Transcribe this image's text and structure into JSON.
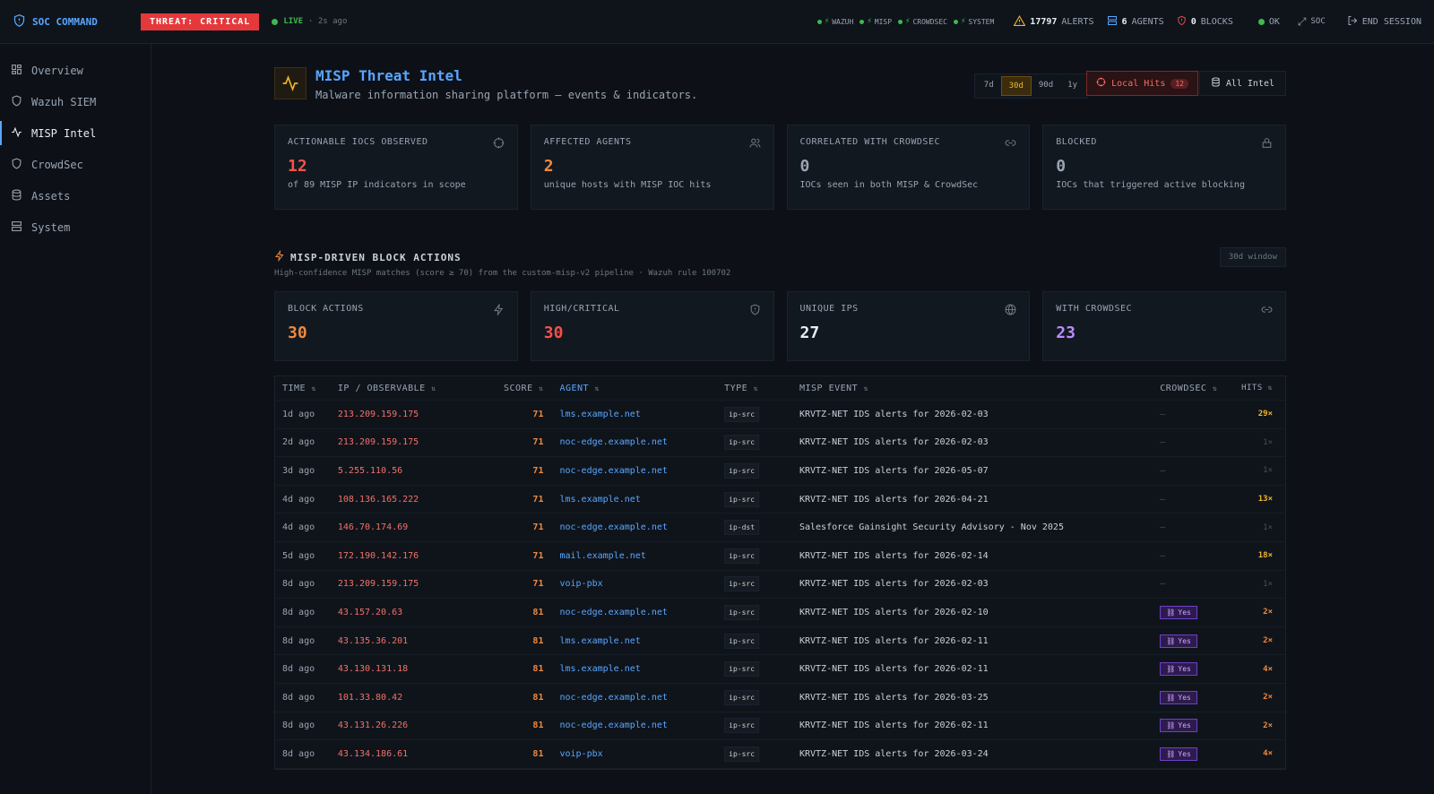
{
  "topbar": {
    "brand": "SOC COMMAND",
    "threat": "THREAT: CRITICAL",
    "live_label": "LIVE",
    "live_time": "· 2s ago",
    "services": [
      "WAZUH",
      "MISP",
      "CROWDSEC",
      "SYSTEM"
    ],
    "alerts_count": "17797",
    "alerts_label": "ALERTS",
    "agents_count": "6",
    "agents_label": "AGENTS",
    "blocks_count": "0",
    "blocks_label": "BLOCKS",
    "ok_label": "OK",
    "soc_label": "SOC",
    "end_session": "END SESSION"
  },
  "sidebar": {
    "items": [
      {
        "label": "Overview",
        "icon": "grid-icon"
      },
      {
        "label": "Wazuh SIEM",
        "icon": "shield-icon"
      },
      {
        "label": "MISP Intel",
        "icon": "activity-icon"
      },
      {
        "label": "CrowdSec",
        "icon": "shield-icon"
      },
      {
        "label": "Assets",
        "icon": "database-icon"
      },
      {
        "label": "System",
        "icon": "server-icon"
      }
    ]
  },
  "header": {
    "title": "MISP Threat Intel",
    "subtitle": "Malware information sharing platform — events & indicators.",
    "ranges": [
      "7d",
      "30d",
      "90d",
      "1y"
    ],
    "selected_range": "30d",
    "local_hits_label": "Local Hits",
    "local_hits_count": "12",
    "all_intel_label": "All Intel"
  },
  "stats": [
    {
      "title": "ACTIONABLE IOCS OBSERVED",
      "value": "12",
      "sub": "of 89 MISP IP indicators in scope",
      "color": "#f85149",
      "icon": "crosshair-icon"
    },
    {
      "title": "AFFECTED AGENTS",
      "value": "2",
      "sub": "unique hosts with MISP IOC hits",
      "color": "#f0883e",
      "icon": "users-icon"
    },
    {
      "title": "CORRELATED WITH CROWDSEC",
      "value": "0",
      "sub": "IOCs seen in both MISP & CrowdSec",
      "color": "#9aa4b2",
      "icon": "link-icon"
    },
    {
      "title": "BLOCKED",
      "value": "0",
      "sub": "IOCs that triggered active blocking",
      "color": "#9aa4b2",
      "icon": "lock-icon"
    }
  ],
  "section": {
    "title": "MISP-DRIVEN BLOCK ACTIONS",
    "subtitle": "High-confidence MISP matches (score ≥ 70) from the custom-misp-v2 pipeline · Wazuh rule 100702",
    "window": "30d window"
  },
  "block_stats": [
    {
      "title": "BLOCK ACTIONS",
      "value": "30",
      "color": "#f0883e",
      "icon": "bolt-icon"
    },
    {
      "title": "HIGH/CRITICAL",
      "value": "30",
      "color": "#f85149",
      "icon": "shield-icon"
    },
    {
      "title": "UNIQUE IPS",
      "value": "27",
      "color": "#e6edf3",
      "icon": "globe-icon"
    },
    {
      "title": "WITH CROWDSEC",
      "value": "23",
      "color": "#bc8cff",
      "icon": "link-icon"
    }
  ],
  "table": {
    "headers": {
      "time": "TIME",
      "ip": "IP / OBSERVABLE",
      "score": "SCORE",
      "agent": "AGENT",
      "type": "TYPE",
      "event": "MISP EVENT",
      "crowdsec": "CROWDSEC",
      "hits": "HITS"
    },
    "yes_label": "Yes",
    "rows": [
      {
        "time": "1d ago",
        "ip": "213.209.159.175",
        "score": "71",
        "agent": "lms.example.net",
        "type": "ip-src",
        "event": "KRVTZ-NET IDS alerts for 2026-02-03",
        "crowdsec": "–",
        "hits": "29×",
        "hits_level": "hot"
      },
      {
        "time": "2d ago",
        "ip": "213.209.159.175",
        "score": "71",
        "agent": "noc-edge.example.net",
        "type": "ip-src",
        "event": "KRVTZ-NET IDS alerts for 2026-02-03",
        "crowdsec": "–",
        "hits": "1×",
        "hits_level": "dim"
      },
      {
        "time": "3d ago",
        "ip": "5.255.110.56",
        "score": "71",
        "agent": "noc-edge.example.net",
        "type": "ip-src",
        "event": "KRVTZ-NET IDS alerts for 2026-05-07",
        "crowdsec": "–",
        "hits": "1×",
        "hits_level": "dim"
      },
      {
        "time": "4d ago",
        "ip": "108.136.165.222",
        "score": "71",
        "agent": "lms.example.net",
        "type": "ip-src",
        "event": "KRVTZ-NET IDS alerts for 2026-04-21",
        "crowdsec": "–",
        "hits": "13×",
        "hits_level": "hot"
      },
      {
        "time": "4d ago",
        "ip": "146.70.174.69",
        "score": "71",
        "agent": "noc-edge.example.net",
        "type": "ip-dst",
        "event": "Salesforce Gainsight Security Advisory - Nov 2025",
        "crowdsec": "–",
        "hits": "1×",
        "hits_level": "dim"
      },
      {
        "time": "5d ago",
        "ip": "172.190.142.176",
        "score": "71",
        "agent": "mail.example.net",
        "type": "ip-src",
        "event": "KRVTZ-NET IDS alerts for 2026-02-14",
        "crowdsec": "–",
        "hits": "18×",
        "hits_level": "hot"
      },
      {
        "time": "8d ago",
        "ip": "213.209.159.175",
        "score": "71",
        "agent": "voip-pbx",
        "type": "ip-src",
        "event": "KRVTZ-NET IDS alerts for 2026-02-03",
        "crowdsec": "–",
        "hits": "1×",
        "hits_level": "dim"
      },
      {
        "time": "8d ago",
        "ip": "43.157.20.63",
        "score": "81",
        "agent": "noc-edge.example.net",
        "type": "ip-src",
        "event": "KRVTZ-NET IDS alerts for 2026-02-10",
        "crowdsec": "yes",
        "hits": "2×",
        "hits_level": "warm"
      },
      {
        "time": "8d ago",
        "ip": "43.135.36.201",
        "score": "81",
        "agent": "lms.example.net",
        "type": "ip-src",
        "event": "KRVTZ-NET IDS alerts for 2026-02-11",
        "crowdsec": "yes",
        "hits": "2×",
        "hits_level": "warm"
      },
      {
        "time": "8d ago",
        "ip": "43.130.131.18",
        "score": "81",
        "agent": "lms.example.net",
        "type": "ip-src",
        "event": "KRVTZ-NET IDS alerts for 2026-02-11",
        "crowdsec": "yes",
        "hits": "4×",
        "hits_level": "warm"
      },
      {
        "time": "8d ago",
        "ip": "101.33.80.42",
        "score": "81",
        "agent": "noc-edge.example.net",
        "type": "ip-src",
        "event": "KRVTZ-NET IDS alerts for 2026-03-25",
        "crowdsec": "yes",
        "hits": "2×",
        "hits_level": "warm"
      },
      {
        "time": "8d ago",
        "ip": "43.131.26.226",
        "score": "81",
        "agent": "noc-edge.example.net",
        "type": "ip-src",
        "event": "KRVTZ-NET IDS alerts for 2026-02-11",
        "crowdsec": "yes",
        "hits": "2×",
        "hits_level": "warm"
      },
      {
        "time": "8d ago",
        "ip": "43.134.186.61",
        "score": "81",
        "agent": "voip-pbx",
        "type": "ip-src",
        "event": "KRVTZ-NET IDS alerts for 2026-03-24",
        "crowdsec": "yes",
        "hits": "4×",
        "hits_level": "warm"
      }
    ]
  },
  "colors": {
    "accent": "#58a6ff",
    "critical": "#e5383b",
    "live": "#3fb950",
    "warning": "#f0b429"
  }
}
